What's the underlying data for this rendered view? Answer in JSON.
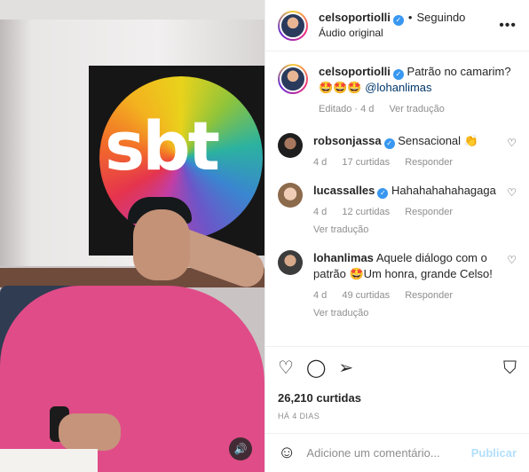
{
  "post": {
    "author": "celsoportiolli",
    "following_label": "Seguindo",
    "audio_label": "Áudio original",
    "more_icon": "more-icon",
    "logo_text": "sbt"
  },
  "caption": {
    "username": "celsoportiolli",
    "text": "Patrão no camarim?",
    "emojis": "🤩🤩🤩",
    "mention": "@lohanlimas",
    "edited": "Editado · 4 d",
    "translate": "Ver tradução"
  },
  "comments": [
    {
      "username": "robsonjassa",
      "text": "Sensacional 👏",
      "time": "4 d",
      "likes": "17 curtidas",
      "reply": "Responder",
      "translate": ""
    },
    {
      "username": "lucassalles",
      "text": "Hahahahahahagaga",
      "time": "4 d",
      "likes": "12 curtidas",
      "reply": "Responder",
      "translate": "Ver tradução"
    },
    {
      "username": "lohanlimas",
      "text": "Aquele diálogo com o patrão 🤩Um honra, grande Celso!",
      "time": "4 d",
      "likes": "49 curtidas",
      "reply": "Responder",
      "translate": "Ver tradução"
    }
  ],
  "actions": {
    "likes": "26,210 curtidas",
    "posted": "HÁ 4 DIAS"
  },
  "composer": {
    "placeholder": "Adicione um comentário...",
    "publish": "Publicar"
  },
  "colors": {
    "link": "#00376b",
    "verified": "#3897f0",
    "publish_disabled": "#b2dffc",
    "muted_text": "#8e8e8e"
  }
}
